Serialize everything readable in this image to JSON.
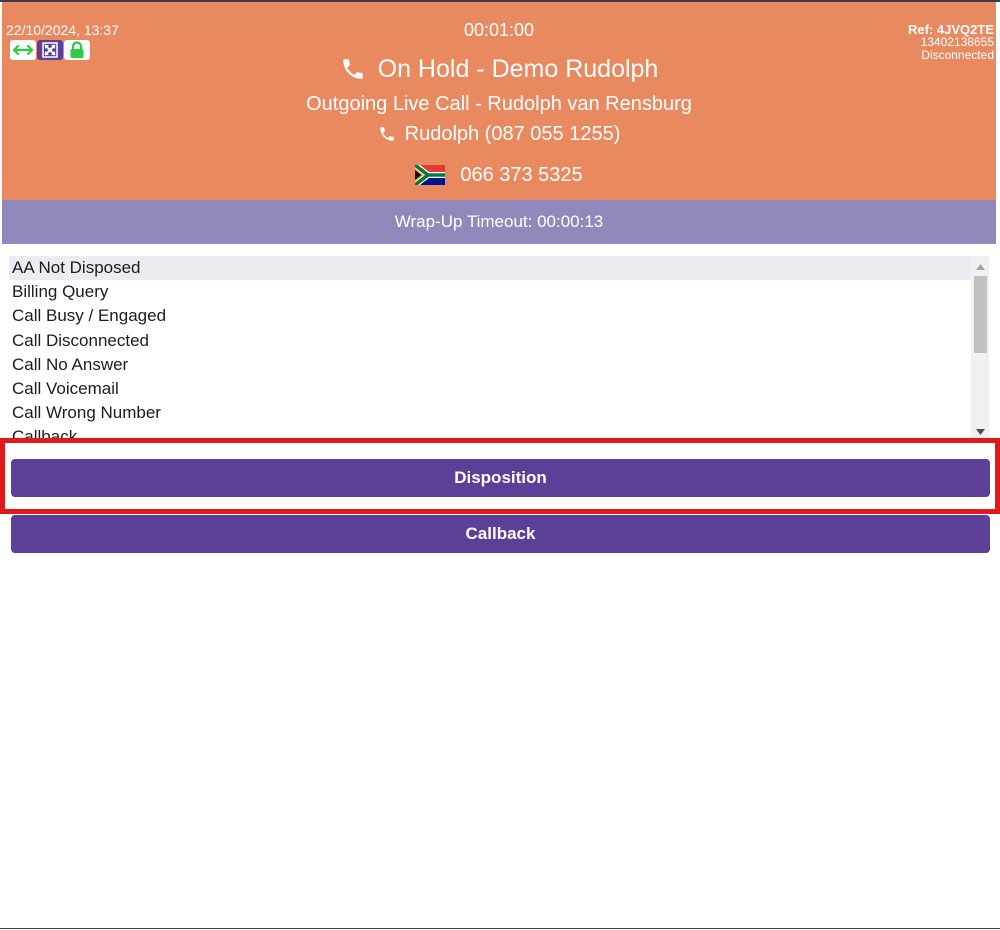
{
  "header": {
    "datetime": "22/10/2024, 13:37",
    "timer": "00:01:00",
    "ref": "Ref: 4JVQ2TE",
    "ref_number": "13402138655",
    "connection_status": "Disconnected",
    "call_status": "On Hold - Demo Rudolph",
    "call_type": "Outgoing Live Call - Rudolph van Rensburg",
    "contact": "Rudolph (087 055 1255)",
    "dialed_number": "066 373 5325",
    "status_icons": [
      "arrows-horizontal-icon",
      "expand-icon",
      "lock-icon"
    ],
    "background_color": "#e98960"
  },
  "wrapup": {
    "label": "Wrap-Up Timeout: 00:00:13",
    "background_color": "#8f8abb"
  },
  "dispositions": {
    "items": [
      "AA Not Disposed",
      "Billing Query",
      "Call Busy / Engaged",
      "Call Disconnected",
      "Call No Answer",
      "Call Voicemail",
      "Call Wrong Number",
      "Callback"
    ],
    "selected": "AA Not Disposed"
  },
  "buttons": {
    "disposition_label": "Disposition",
    "callback_label": "Callback",
    "color": "#5c3f96"
  },
  "highlight_color": "#e01a1a"
}
